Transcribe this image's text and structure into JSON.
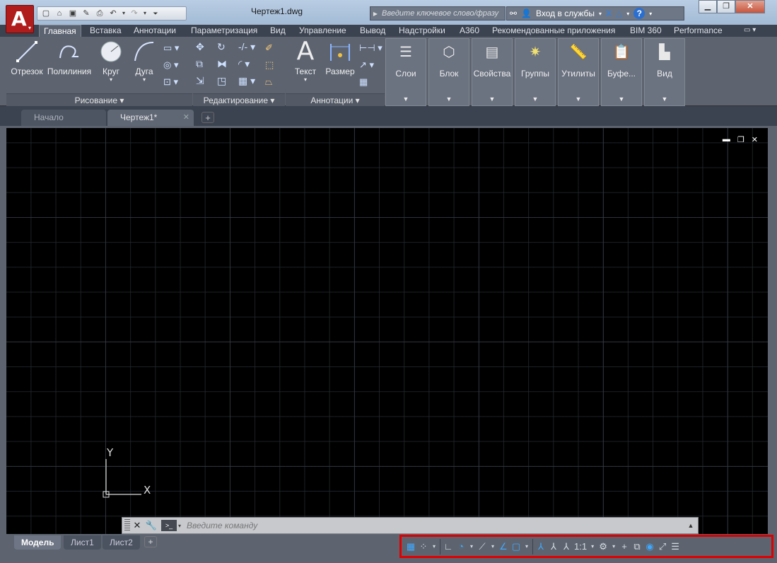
{
  "titlebar": {
    "document_title": "Чертеж1.dwg",
    "search_placeholder": "Введите ключевое слово/фразу",
    "signin_label": "Вход в службы"
  },
  "ribbon": {
    "tabs": [
      "Главная",
      "Вставка",
      "Аннотации",
      "Параметризация",
      "Вид",
      "Управление",
      "Вывод",
      "Надстройки",
      "A360",
      "Рекомендованные приложения",
      "BIM 360",
      "Performance"
    ],
    "active_tab": "Главная",
    "draw": {
      "line": "Отрезок",
      "polyline": "Полилиния",
      "circle": "Круг",
      "arc": "Дуга",
      "panel_title": "Рисование"
    },
    "modify": {
      "panel_title": "Редактирование"
    },
    "annotation": {
      "text": "Текст",
      "dimension": "Размер",
      "panel_title": "Аннотации"
    },
    "groups": [
      "Слои",
      "Блок",
      "Свойства",
      "Группы",
      "Утилиты",
      "Буфе...",
      "Вид"
    ]
  },
  "doc_tabs": {
    "start": "Начало",
    "drawing": "Чертеж1*"
  },
  "canvas": {
    "ucs_x": "X",
    "ucs_y": "Y"
  },
  "command_line": {
    "placeholder": "Введите команду"
  },
  "layout_tabs": [
    "Модель",
    "Лист1",
    "Лист2"
  ],
  "status_bar": {
    "scale": "1:1"
  },
  "colors": {
    "accent_red": "#e00000",
    "canvas_bg": "#000000",
    "ribbon_bg": "#5d6470",
    "app_button": "#b01c1c",
    "status_blue": "#3fa9ff"
  }
}
